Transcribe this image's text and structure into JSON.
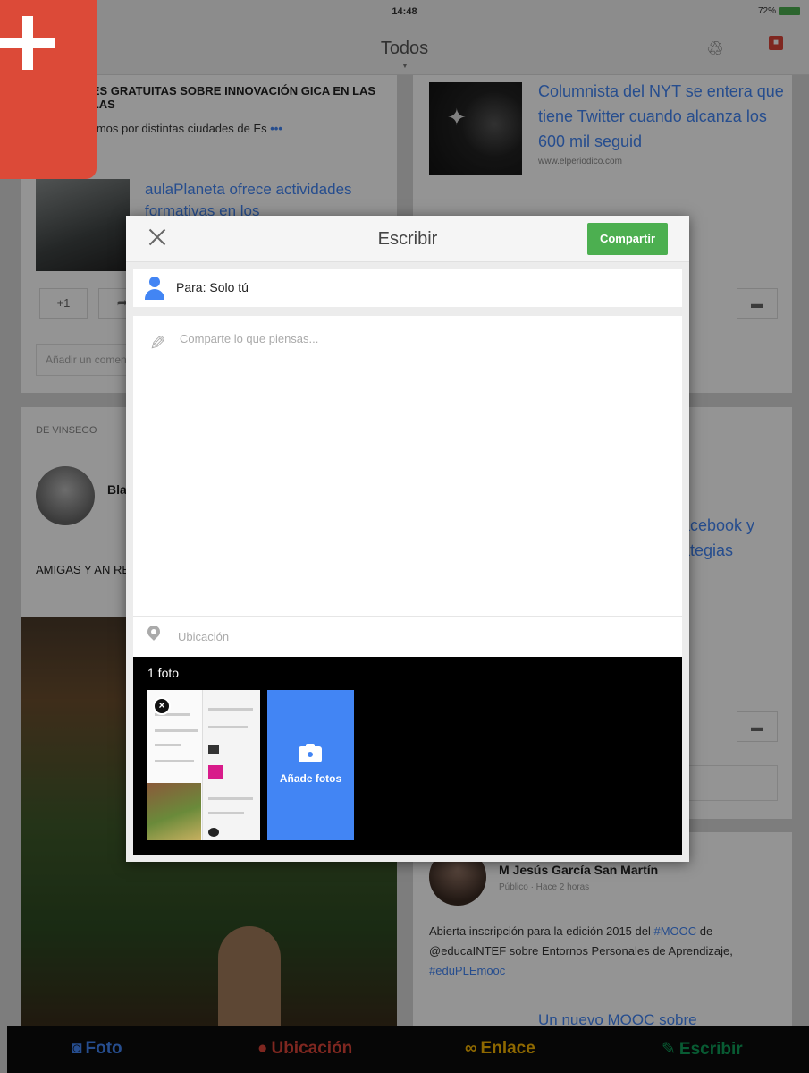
{
  "status_bar": {
    "time": "14:48",
    "battery": "72%"
  },
  "header": {
    "title": "Todos"
  },
  "feed": {
    "card1": {
      "headline": "RNES GRATUITAS SOBRE INNOVACIÓN GICA EN LAS AULAS",
      "line": "lazamos por distintas ciudades de Es",
      "link_title": "aulaPlaneta ofrece actividades formativas en los",
      "plus_one": "+1",
      "comment_placeholder": "Añadir un comentario..."
    },
    "card2": {
      "link_title": "Columnista del NYT se entera que tiene Twitter cuando alcanza los 600 mil seguid",
      "source": "www.elperiodico.com"
    },
    "card3": {
      "label": "DE VINSEGO",
      "name": "Bla",
      "text": "AMIGAS Y AN REPASO. PER"
    },
    "card4": {
      "link_title": "acebook y ategias"
    },
    "card5": {
      "name": "M Jesús García San Martín",
      "sub": "Público · Hace 2 horas",
      "text_a": "Abierta inscripción para la edición 2015 del ",
      "tag1": "#MOOC",
      "text_b": " de @educaINTEF sobre Entornos Personales de Aprendizaje, ",
      "tag2": "#eduPLEmooc",
      "more_title": "Un nuevo MOOC sobre"
    }
  },
  "bottom_bar": {
    "foto": "Foto",
    "ubicacion": "Ubicación",
    "enlace": "Enlace",
    "escribir": "Escribir"
  },
  "dialog": {
    "title": "Escribir",
    "share_label": "Compartir",
    "audience": "Para: Solo tú",
    "compose_placeholder": "Comparte lo que piensas...",
    "location_placeholder": "Ubicación",
    "photos_count": "1 foto",
    "add_photos_label": "Añade fotos"
  },
  "colors": {
    "share_button": "#4caf50",
    "fab": "#dc4a38",
    "add_photos": "#4285f4",
    "accent": "#4285f4"
  },
  "icons": [
    "plus-icon",
    "bell-icon",
    "notifications-icon",
    "close-icon",
    "person-icon",
    "pencil-icon",
    "location-pin-icon",
    "remove-icon",
    "camera-icon",
    "twitter-bird-icon",
    "comment-icon",
    "share-icon"
  ]
}
